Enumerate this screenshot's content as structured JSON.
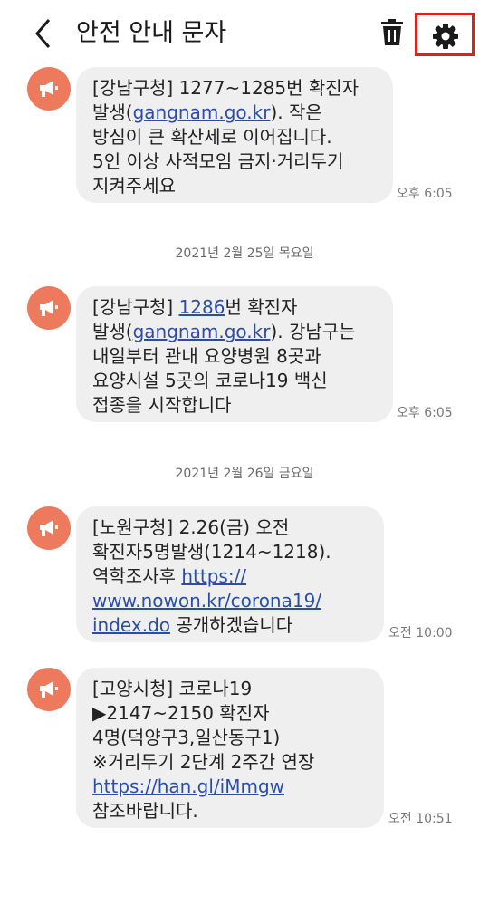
{
  "header": {
    "title": "안전 안내 문자",
    "back_icon": "chevron-left-icon",
    "delete_icon": "trash-icon",
    "settings_icon": "gear-icon"
  },
  "colors": {
    "avatar": "#ee7a5e",
    "bubble": "#efefef",
    "link": "#2a4ea8",
    "highlight_box": "#e0201b"
  },
  "dates": {
    "d1": "2021년 2월 25일 목요일",
    "d2": "2021년 2월 26일 금요일"
  },
  "messages": [
    {
      "time": "오후 6:05",
      "line1": "[강남구청] 1277~1285번 확진자",
      "line2_pre": "발생(",
      "line2_link": "gangnam.go.kr",
      "line2_post": "). 작은",
      "line3": "방심이 큰 확산세로 이어집니다.",
      "line4": "5인 이상 사적모임 금지·거리두기",
      "line5": "지켜주세요"
    },
    {
      "time": "오후 6:05",
      "line1_pre": "[강남구청] ",
      "line1_link": "1286",
      "line1_post": "번 확진자",
      "line2_pre": "발생(",
      "line2_link": "gangnam.go.kr",
      "line2_post": "). 강남구는",
      "line3": "내일부터 관내 요양병원 8곳과",
      "line4": "요양시설 5곳의 코로나19 백신",
      "line5": "접종을 시작합니다"
    },
    {
      "time": "오전 10:00",
      "line1": "[노원구청] 2.26(금) 오전",
      "line2": "확진자5명발생(1214~1218).",
      "line3_pre": "역학조사후 ",
      "line3_link": "https://",
      "line4_link": "www.nowon.kr/corona19/",
      "line5_link": "index.do",
      "line5_post": " 공개하겠습니다"
    },
    {
      "time": "오전 10:51",
      "line1": "[고양시청] 코로나19",
      "line2": "▶2147~2150 확진자",
      "line3": "4명(덕양구3,일산동구1)",
      "line4": "※거리두기 2단계 2주간 연장",
      "line5_link": "https://han.gl/iMmgw",
      "line6": "참조바랍니다."
    }
  ]
}
